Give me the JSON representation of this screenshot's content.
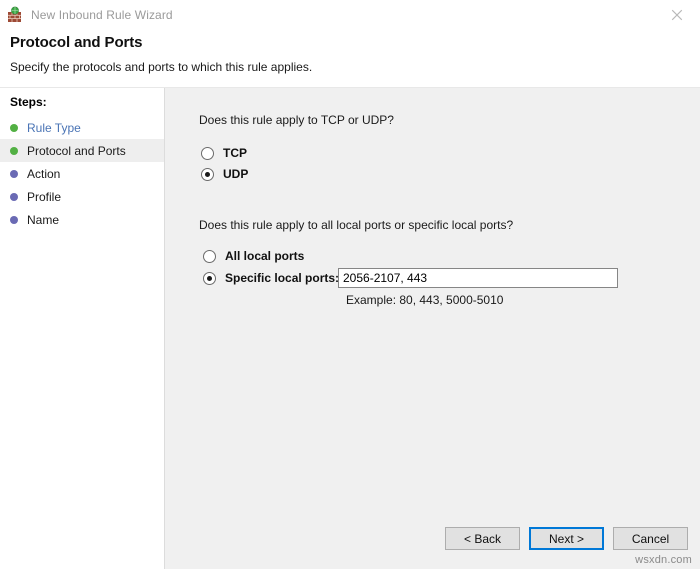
{
  "window": {
    "title": "New Inbound Rule Wizard",
    "icon": "firewall-rule-icon",
    "close_label": "✕"
  },
  "header": {
    "title": "Protocol and Ports",
    "subtitle": "Specify the protocols and ports to which this rule applies."
  },
  "sidebar": {
    "label": "Steps:",
    "items": [
      {
        "label": "Rule Type",
        "state": "done",
        "bullet_color": "#52b043",
        "link": true
      },
      {
        "label": "Protocol and Ports",
        "state": "current",
        "bullet_color": "#52b043",
        "link": false
      },
      {
        "label": "Action",
        "state": "upcoming",
        "bullet_color": "#6a6ab4",
        "link": false
      },
      {
        "label": "Profile",
        "state": "upcoming",
        "bullet_color": "#6a6ab4",
        "link": false
      },
      {
        "label": "Name",
        "state": "upcoming",
        "bullet_color": "#6a6ab4",
        "link": false
      }
    ]
  },
  "main": {
    "protocol_question": "Does this rule apply to TCP or UDP?",
    "protocol_options": [
      {
        "label": "TCP",
        "checked": false
      },
      {
        "label": "UDP",
        "checked": true
      }
    ],
    "ports_question": "Does this rule apply to all local ports or specific local ports?",
    "ports_options": [
      {
        "label": "All local ports",
        "checked": false
      },
      {
        "label": "Specific local ports:",
        "checked": true
      }
    ],
    "ports_value": "2056-2107, 443",
    "ports_placeholder": "",
    "example_text": "Example: 80, 443, 5000-5010"
  },
  "footer": {
    "buttons": [
      {
        "label": "< Back",
        "default": false
      },
      {
        "label": "Next >",
        "default": true
      },
      {
        "label": "Cancel",
        "default": false
      }
    ]
  },
  "watermark": "wsxdn.com",
  "colors": {
    "accent": "#0078d7",
    "step_done": "#52b043",
    "step_upcoming": "#6a6ab4",
    "link": "#4a74b5",
    "content_bg": "#f0f0f0"
  }
}
